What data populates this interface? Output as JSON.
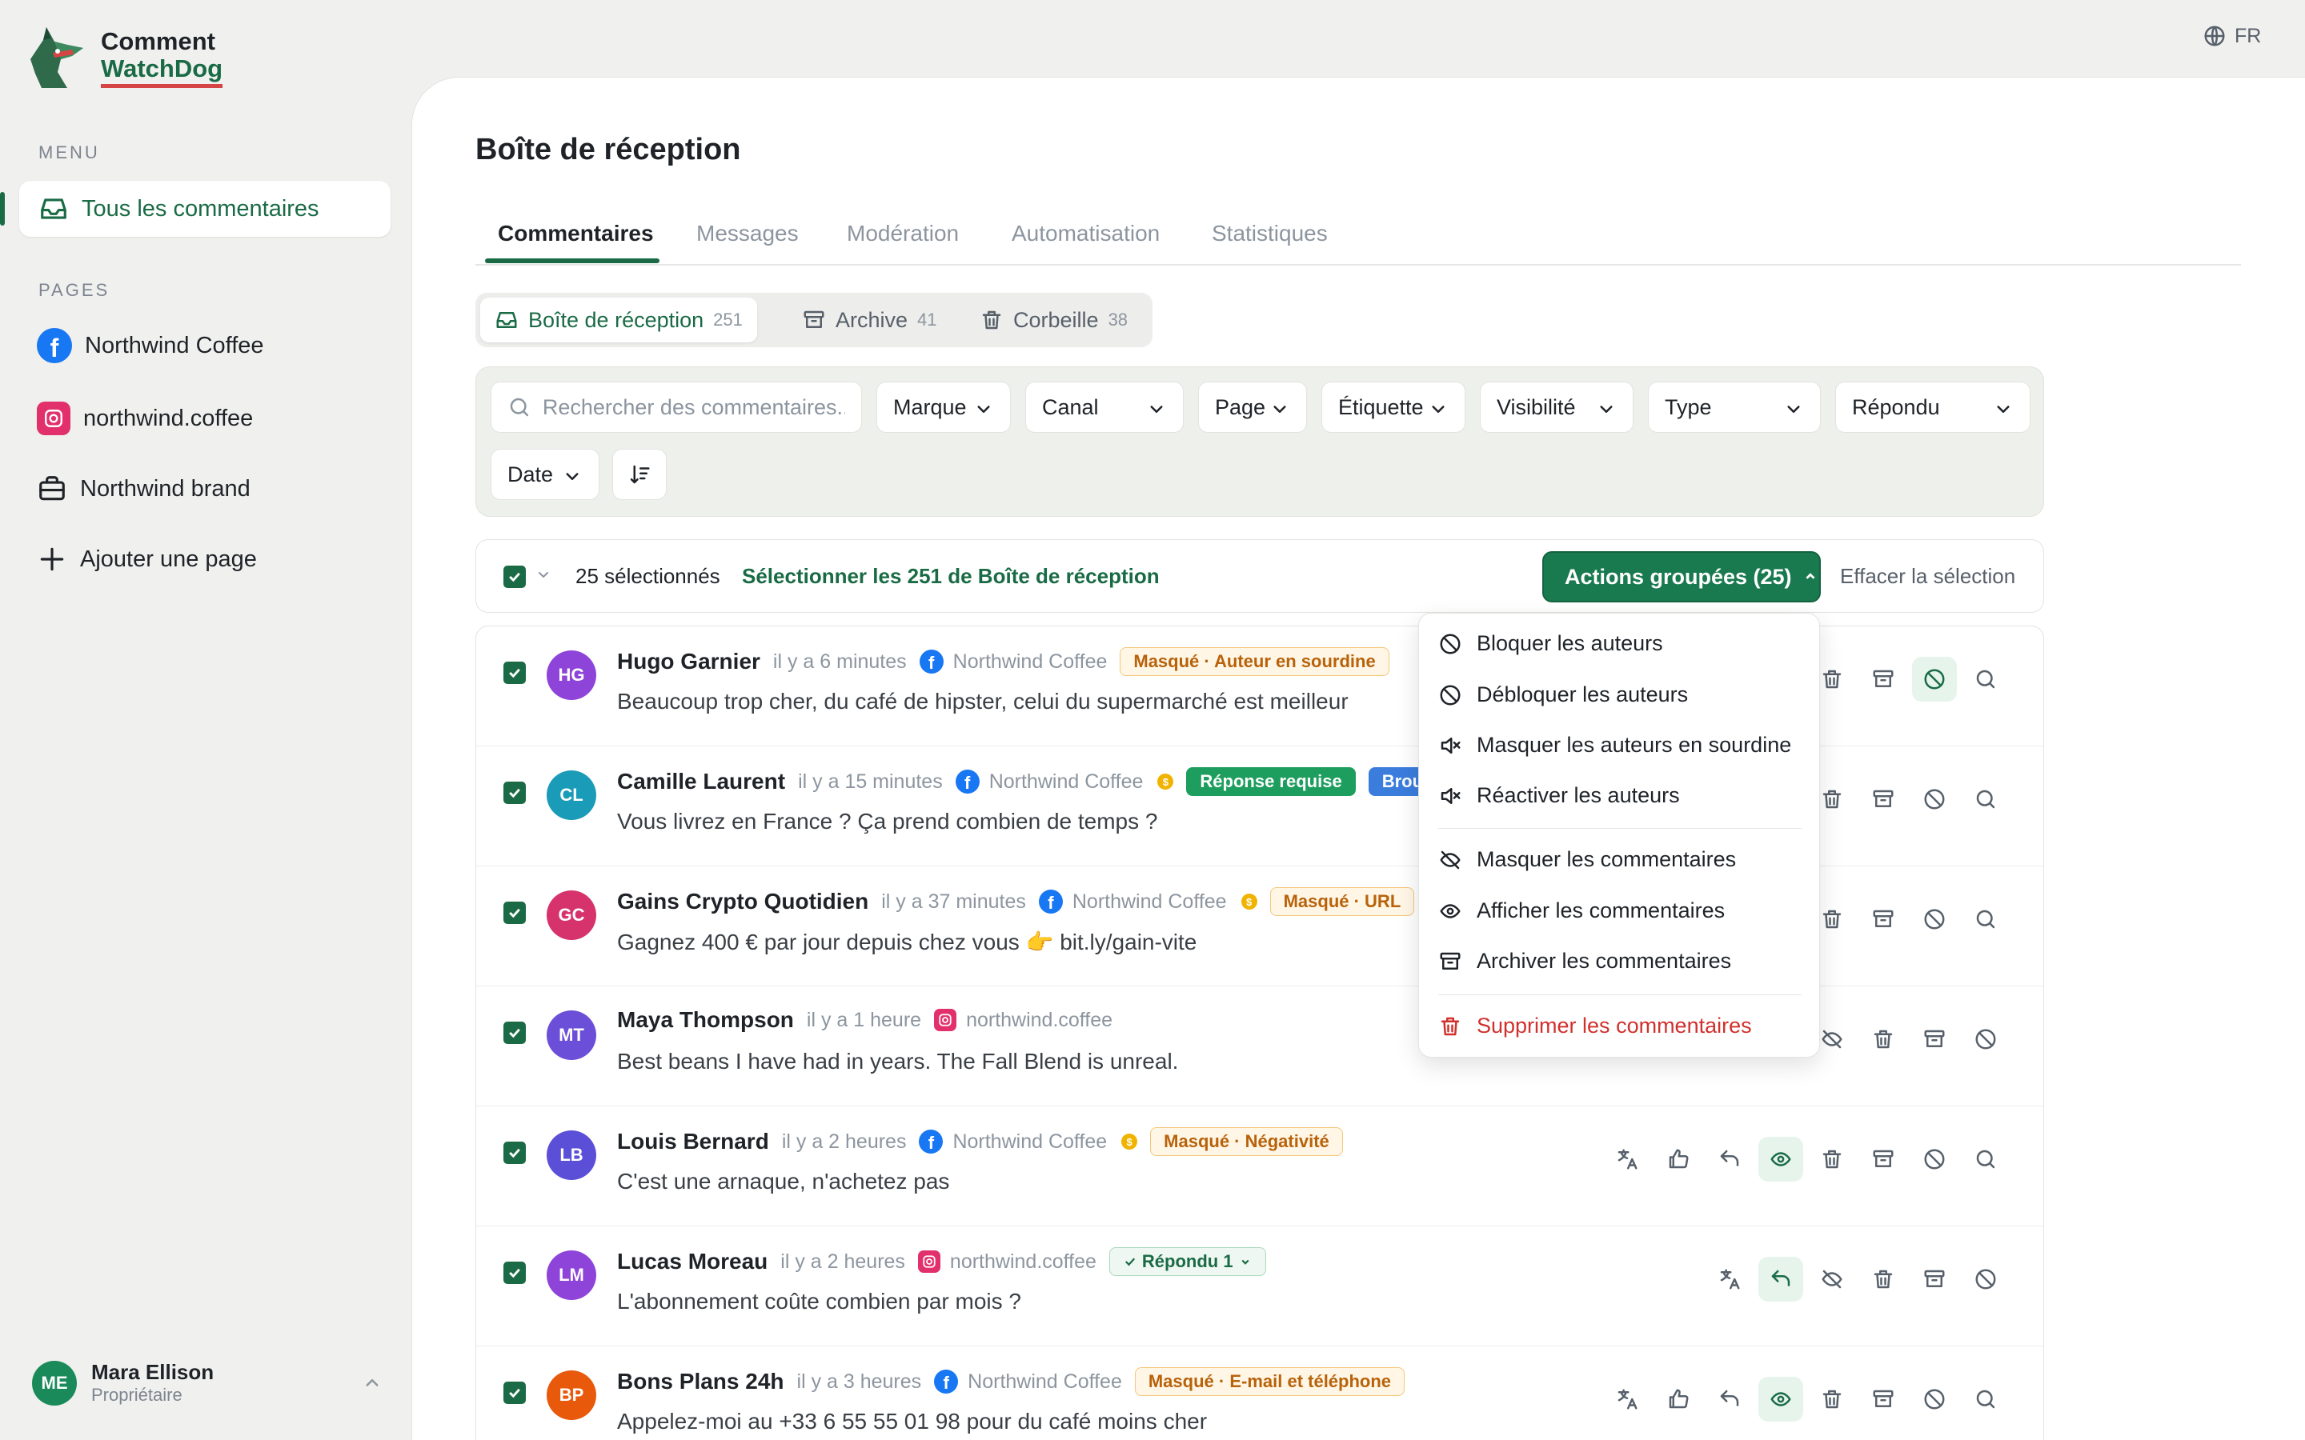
{
  "app": {
    "name_line1": "Comment",
    "name_line2": "WatchDog",
    "language": "FR"
  },
  "sidebar": {
    "menu_heading": "MENU",
    "all_comments": "Tous les commentaires",
    "pages_heading": "PAGES",
    "pages": [
      {
        "label": "Northwind Coffee",
        "icon": "facebook-icon"
      },
      {
        "label": "northwind.coffee",
        "icon": "instagram-icon"
      },
      {
        "label": "Northwind brand",
        "icon": "briefcase-icon"
      }
    ],
    "add_page": "Ajouter une page",
    "user": {
      "initials": "ME",
      "name": "Mara Ellison",
      "role": "Propriétaire"
    }
  },
  "main": {
    "title": "Boîte de réception",
    "tabs": [
      "Commentaires",
      "Messages",
      "Modération",
      "Automatisation",
      "Statistiques"
    ],
    "active_tab": "Commentaires",
    "segments": [
      {
        "label": "Boîte de réception",
        "count": "251"
      },
      {
        "label": "Archive",
        "count": "41"
      },
      {
        "label": "Corbeille",
        "count": "38"
      }
    ],
    "filters": {
      "search_placeholder": "Rechercher des commentaires...",
      "dropdowns": [
        "Marque",
        "Canal",
        "Page",
        "Étiquette",
        "Visibilité",
        "Type",
        "Répondu",
        "Date"
      ]
    },
    "selection": {
      "count_text": "25 sélectionnés",
      "select_all": "Sélectionner les 251 de Boîte de réception",
      "bulk_actions": "Actions groupées (25)",
      "clear": "Effacer la sélection"
    },
    "bulk_menu": {
      "items": [
        {
          "label": "Bloquer les auteurs",
          "icon": "block-icon"
        },
        {
          "label": "Débloquer les auteurs",
          "icon": "block-icon"
        },
        {
          "label": "Masquer les auteurs en sourdine",
          "icon": "mute-icon"
        },
        {
          "label": "Réactiver les auteurs",
          "icon": "mute-icon"
        },
        {
          "label": "Masquer les commentaires",
          "icon": "eye-off-icon"
        },
        {
          "label": "Afficher les commentaires",
          "icon": "eye-icon"
        },
        {
          "label": "Archiver les commentaires",
          "icon": "archive-icon"
        },
        {
          "label": "Supprimer les commentaires",
          "icon": "trash-icon"
        }
      ]
    },
    "comments": [
      {
        "initials": "HG",
        "avatar_color": "#8e44d9",
        "author": "Hugo Garnier",
        "time": "il y a 6 minutes",
        "source": "Northwind Coffee",
        "channel": "facebook",
        "badges": [
          {
            "text": "Masqué · Auteur en sourdine",
            "style": "orange"
          }
        ],
        "text": "Beaucoup trop cher, du café de hipster, celui du supermarché est meilleur"
      },
      {
        "initials": "CL",
        "avatar_color": "#1a9bb8",
        "author": "Camille Laurent",
        "time": "il y a 15 minutes",
        "source": "Northwind Coffee",
        "channel": "facebook",
        "coin": true,
        "badges": [
          {
            "text": "Réponse requise",
            "style": "green"
          },
          {
            "text": "Brou",
            "style": "blue"
          }
        ],
        "text": "Vous livrez en France ? Ça prend combien de temps ?"
      },
      {
        "initials": "GC",
        "avatar_color": "#d6336c",
        "author": "Gains Crypto Quotidien",
        "time": "il y a 37 minutes",
        "source": "Northwind Coffee",
        "channel": "facebook",
        "coin": true,
        "badges": [
          {
            "text": "Masqué · URL",
            "style": "orange"
          }
        ],
        "text": "Gagnez 400 € par jour depuis chez vous 👉  bit.ly/gain-vite"
      },
      {
        "initials": "MT",
        "avatar_color": "#6c4fd8",
        "author": "Maya Thompson",
        "time": "il y a 1 heure",
        "source": "northwind.coffee",
        "channel": "instagram",
        "badges": [],
        "text": "Best beans I have had in years. The Fall Blend is unreal."
      },
      {
        "initials": "LB",
        "avatar_color": "#5b4fd8",
        "author": "Louis Bernard",
        "time": "il y a 2 heures",
        "source": "Northwind Coffee",
        "channel": "facebook",
        "coin": true,
        "badges": [
          {
            "text": "Masqué · Négativité",
            "style": "orange"
          }
        ],
        "text": "C'est une arnaque, n'achetez pas"
      },
      {
        "initials": "LM",
        "avatar_color": "#8e44d9",
        "author": "Lucas Moreau",
        "time": "il y a 2 heures",
        "source": "northwind.coffee",
        "channel": "instagram",
        "badges": [
          {
            "text": "Répondu 1",
            "style": "replied"
          }
        ],
        "text": "L'abonnement coûte combien par mois ?"
      },
      {
        "initials": "BP",
        "avatar_color": "#e8590c",
        "author": "Bons Plans 24h",
        "time": "il y a 3 heures",
        "source": "Northwind Coffee",
        "channel": "facebook",
        "badges": [
          {
            "text": "Masqué · E-mail et téléphone",
            "style": "orange"
          }
        ],
        "text": "Appelez-moi au +33 6 55 55 01 98 pour du café moins cher"
      }
    ]
  }
}
